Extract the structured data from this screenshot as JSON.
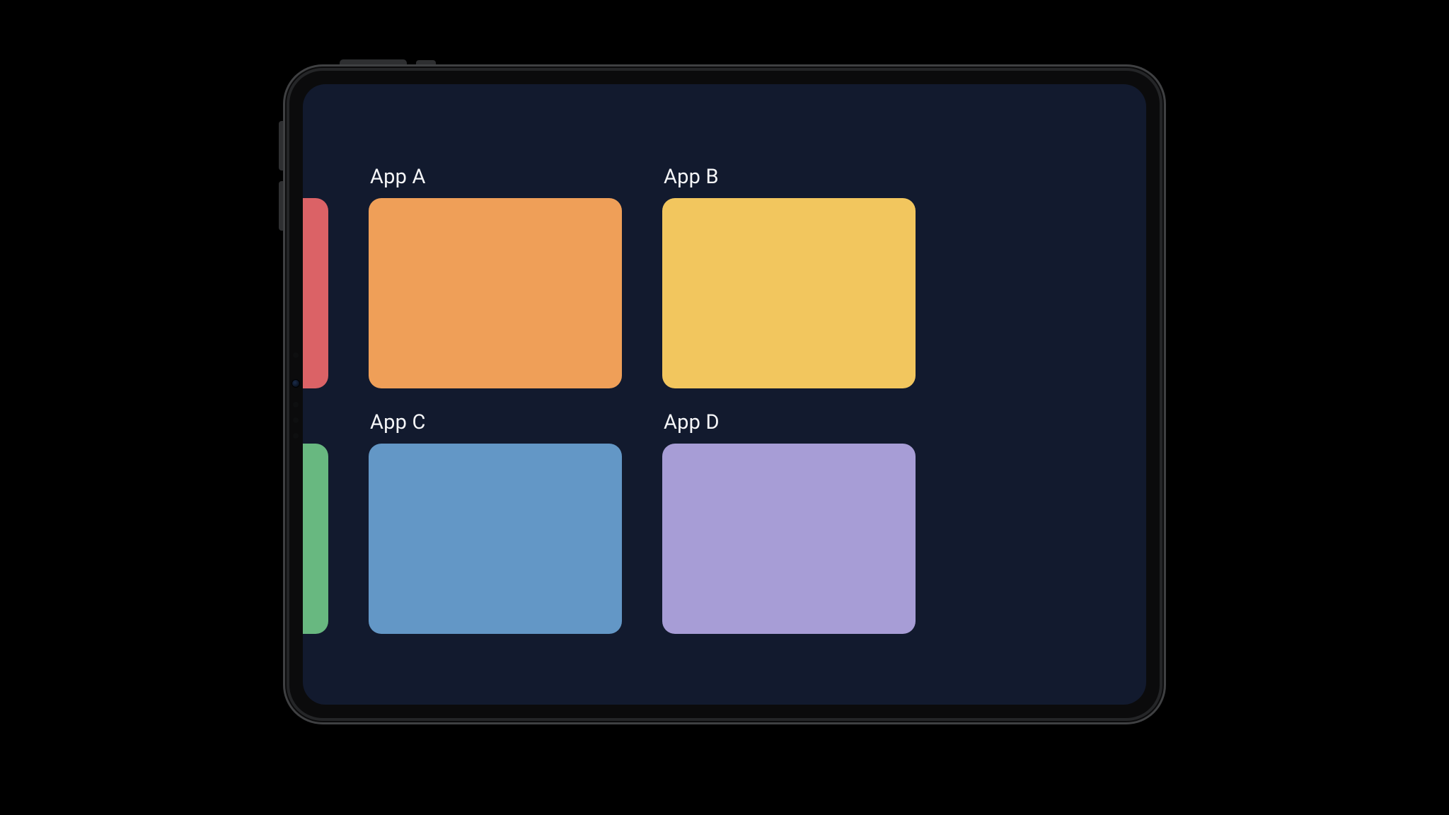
{
  "screen_bg": "#121a2e",
  "cards": {
    "col0": {
      "top": {
        "label": "",
        "color": "#db6266"
      },
      "bottom": {
        "label": "",
        "color": "#68b880"
      }
    },
    "col1": {
      "top": {
        "label": "App A",
        "color": "#ef9f58"
      },
      "bottom": {
        "label": "App C",
        "color": "#6397c6"
      }
    },
    "col2": {
      "top": {
        "label": "App B",
        "color": "#f2c65e"
      },
      "bottom": {
        "label": "App D",
        "color": "#a79dd6"
      }
    }
  }
}
